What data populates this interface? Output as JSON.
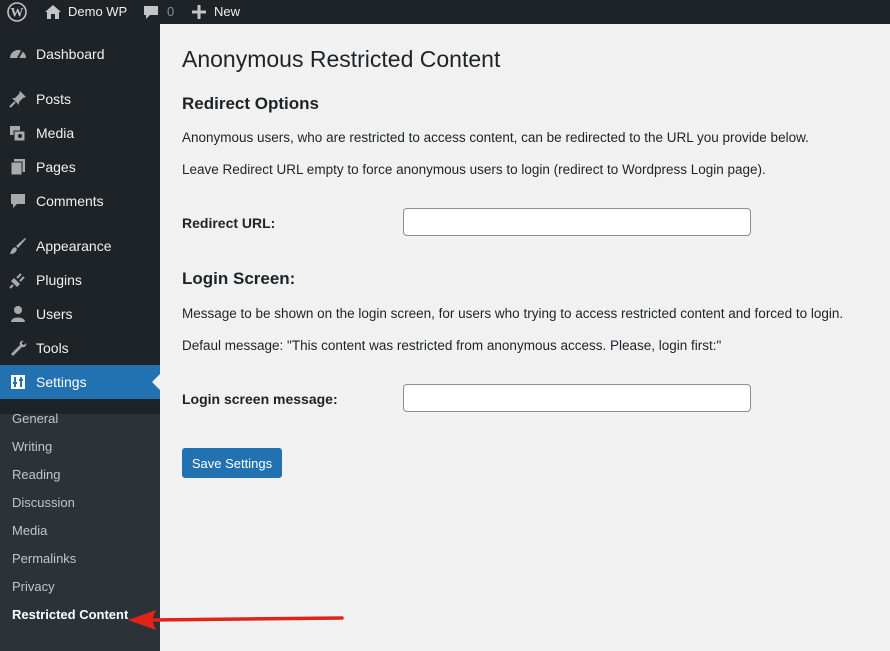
{
  "adminbar": {
    "site_name": "Demo WP",
    "comments_count": "0",
    "new_label": "New"
  },
  "sidebar": {
    "items": [
      {
        "label": "Dashboard",
        "icon": "dashboard-icon"
      },
      {
        "label": "Posts",
        "icon": "pin-icon"
      },
      {
        "label": "Media",
        "icon": "media-icon"
      },
      {
        "label": "Pages",
        "icon": "pages-icon"
      },
      {
        "label": "Comments",
        "icon": "comment-icon"
      },
      {
        "label": "Appearance",
        "icon": "brush-icon"
      },
      {
        "label": "Plugins",
        "icon": "plug-icon"
      },
      {
        "label": "Users",
        "icon": "user-icon"
      },
      {
        "label": "Tools",
        "icon": "wrench-icon"
      },
      {
        "label": "Settings",
        "icon": "settings-icon",
        "active": true
      }
    ],
    "submenu": [
      {
        "label": "General"
      },
      {
        "label": "Writing"
      },
      {
        "label": "Reading"
      },
      {
        "label": "Discussion"
      },
      {
        "label": "Media"
      },
      {
        "label": "Permalinks"
      },
      {
        "label": "Privacy"
      },
      {
        "label": "Restricted Content",
        "current": true
      }
    ]
  },
  "page": {
    "title": "Anonymous Restricted Content",
    "redirect": {
      "heading": "Redirect Options",
      "desc1": "Anonymous users, who are restricted to access content, can be redirected to the URL you provide below.",
      "desc2": "Leave Redirect URL empty to force anonymous users to login (redirect to Wordpress Login page).",
      "field_label": "Redirect URL:",
      "field_value": ""
    },
    "login": {
      "heading": "Login Screen:",
      "desc1": "Message to be shown on the login screen, for users who trying to access restricted content and forced to login.",
      "desc2": "Defaul message: \"This content was restricted from anonymous access. Please, login first:\"",
      "field_label": "Login screen message:",
      "field_value": ""
    },
    "save_label": "Save Settings"
  },
  "colors": {
    "sidebar_bg": "#1d2327",
    "submenu_bg": "#2c3338",
    "accent": "#2271b1",
    "content_bg": "#f1f1f1",
    "annotation": "#e2231a"
  }
}
